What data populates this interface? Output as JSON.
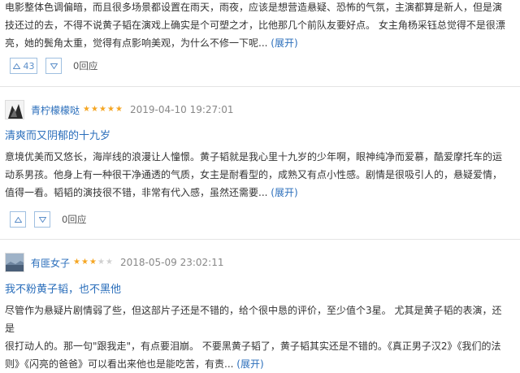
{
  "reviews": [
    {
      "body_lines": [
        "电影整体色调偏暗，而且很多场景都设置在雨天，雨夜，应该是想营造悬疑、恐怖的气氛，主演都算是新人，但是演",
        "技还过的去，不得不说黄子韬在演戏上确实是个可塑之才，比他那几个前队友要好点。 女主角杨采钰总觉得不是很漂",
        "亮，她的鬓角太重，觉得有点影响美观，为什么不修一下呢..."
      ],
      "expand_label": "(展开)",
      "upvotes": "43",
      "reply_label": "0回应"
    },
    {
      "username": "青柠檬檬哒",
      "rating": 5,
      "date": "2019-04-10 19:27:01",
      "title": "清爽而又阴郁的十九岁",
      "body_lines": [
        "意境优美而又悠长，海岸线的浪漫让人憧憬。黄子韬就是我心里十九岁的少年啊，眼神纯净而爱慕，酷爱摩托车的运",
        "动系男孩。他身上有一种很干净通透的气质，女主是耐看型的，成熟又有点小性感。剧情是很吸引人的，悬疑爱情，",
        "值得一看。韬韬的演技很不错，非常有代入感，虽然还需要..."
      ],
      "expand_label": "(展开)",
      "reply_label": "0回应"
    },
    {
      "username": "有匪女子",
      "rating": 3,
      "date": "2018-05-09 23:02:11",
      "title": "我不粉黄子韬，也不黑他",
      "body_lines": [
        "尽管作为悬疑片剧情弱了些，但这部片子还是不错的，给个很中恳的评价，至少值个3星。 尤其是黄子韬的表演，还是",
        "很打动人的。那一句\"跟我走\"，有点要泪崩。 不要黑黄子韬了，黄子韬其实还是不错的。《真正男子汉2》《我们的法",
        "则》《闪亮的爸爸》可以看出来他也是能吃苦，有责..."
      ],
      "expand_label": "(展开)"
    }
  ],
  "colors": {
    "link": "#2a6ebb",
    "star": "#f5a623",
    "text": "#333333",
    "meta": "#888888"
  },
  "icons": {
    "upvote": "thumb-up-triangle",
    "downvote": "thumb-down-triangle"
  }
}
